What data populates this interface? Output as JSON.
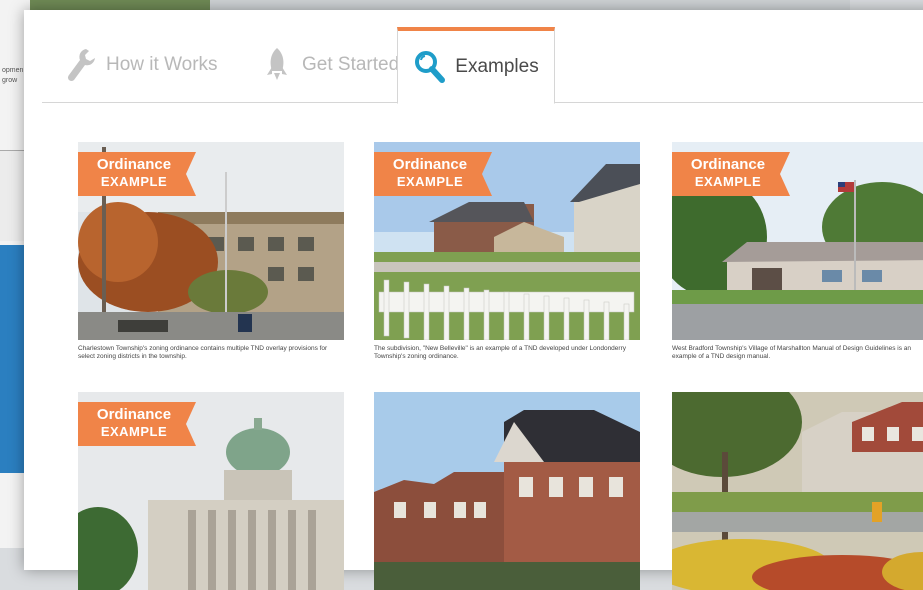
{
  "background": {
    "left_text": [
      "opmen",
      "grow"
    ]
  },
  "tabs": [
    {
      "label": "How it Works",
      "icon": "wrench-icon",
      "active": false
    },
    {
      "label": "Get Started",
      "icon": "rocket-icon",
      "active": false
    },
    {
      "label": "Examples",
      "icon": "magnifier-icon",
      "active": true
    }
  ],
  "ribbon": {
    "line1": "Ordinance",
    "line2": "EXAMPLE"
  },
  "colors": {
    "accent": "#f08448",
    "active_tab_border": "#f08448"
  },
  "examples": [
    {
      "caption": "Charlestown Township's zoning ordinance contains multiple TND overlay provisions for select zoning districts in the township.",
      "has_ribbon": true
    },
    {
      "caption": "The subdivision, \"New Belleville\" is an example of a TND developed under Londonderry Township's zoning ordinance.",
      "has_ribbon": true
    },
    {
      "caption": "West Bradford Township's Village of Marshallton Manual of Design Guidelines is an example of a TND design manual.",
      "has_ribbon": true
    },
    {
      "caption": "",
      "has_ribbon": true
    },
    {
      "caption": "",
      "has_ribbon": false
    },
    {
      "caption": "",
      "has_ribbon": false
    }
  ]
}
